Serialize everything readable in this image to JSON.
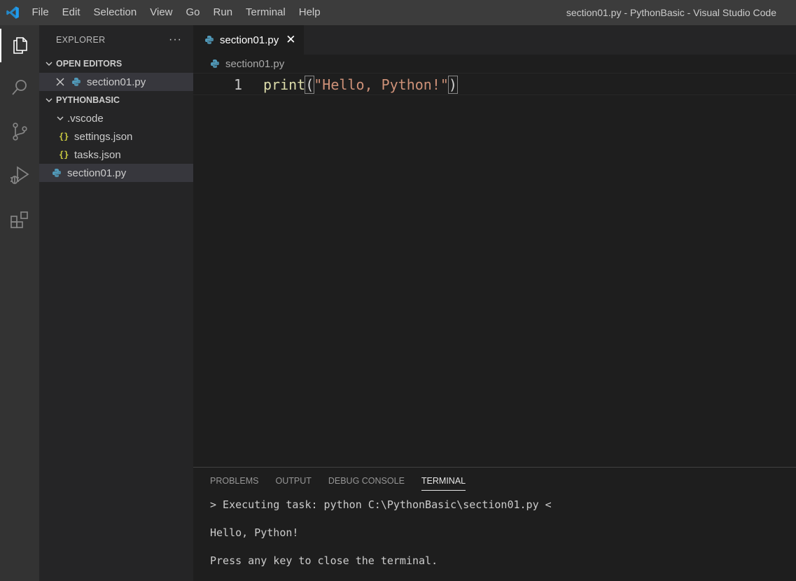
{
  "menu": [
    "File",
    "Edit",
    "Selection",
    "View",
    "Go",
    "Run",
    "Terminal",
    "Help"
  ],
  "window_title": "section01.py - PythonBasic - Visual Studio Code",
  "activity": [
    "explorer-icon",
    "search-icon",
    "source-control-icon",
    "run-debug-icon",
    "extensions-icon"
  ],
  "sidebar": {
    "title": "EXPLORER",
    "more": "···",
    "open_editors": {
      "label": "OPEN EDITORS",
      "items": [
        {
          "name": "section01.py"
        }
      ]
    },
    "folder": {
      "label": "PYTHONBASIC",
      "vscode_folder": ".vscode",
      "vscode_files": [
        "settings.json",
        "tasks.json"
      ],
      "root_file": "section01.py"
    }
  },
  "editor": {
    "tab_label": "section01.py",
    "tab_close": "✕",
    "breadcrumb": "section01.py",
    "line_number": "1",
    "code": {
      "fn": "print",
      "open": "(",
      "str": "\"Hello, Python!\"",
      "close": ")"
    }
  },
  "panel": {
    "tabs": [
      "PROBLEMS",
      "OUTPUT",
      "DEBUG CONSOLE",
      "TERMINAL"
    ],
    "active_tab": "TERMINAL",
    "terminal_lines": [
      "> Executing task: python C:\\PythonBasic\\section01.py <",
      "Hello, Python!",
      "Press any key to close the terminal."
    ]
  },
  "colors": {
    "accent": "#007acc",
    "python_icon": "#519aba",
    "json_icon": "#cbcb41"
  }
}
